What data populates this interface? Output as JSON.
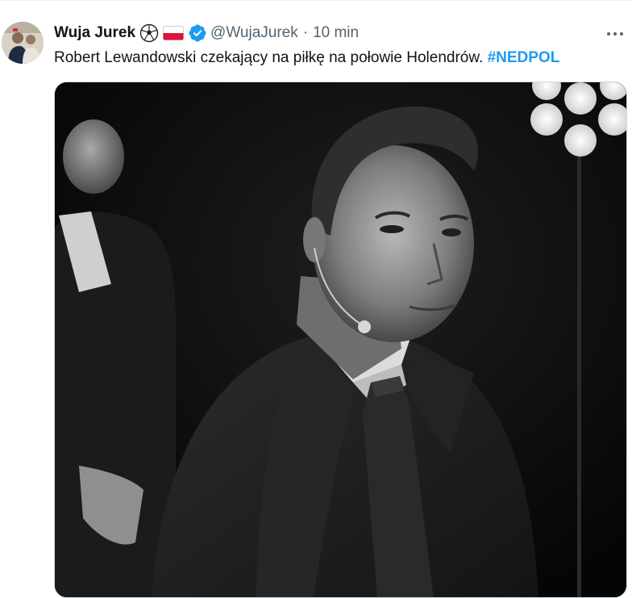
{
  "tweet": {
    "display_name": "Wuja Jurek",
    "emoji": [
      "soccer-ball",
      "poland-flag"
    ],
    "verified": true,
    "handle": "@WujaJurek",
    "separator": "·",
    "time": "10 min",
    "text": "Robert Lewandowski czekający na piłkę na połowie Holendrów.",
    "hashtag": "#NEDPOL",
    "more_icon": "more-horizontal-icon",
    "media_alt": "photo"
  },
  "colors": {
    "text_primary": "#0f1419",
    "text_secondary": "#536471",
    "accent": "#1d9bf0"
  }
}
